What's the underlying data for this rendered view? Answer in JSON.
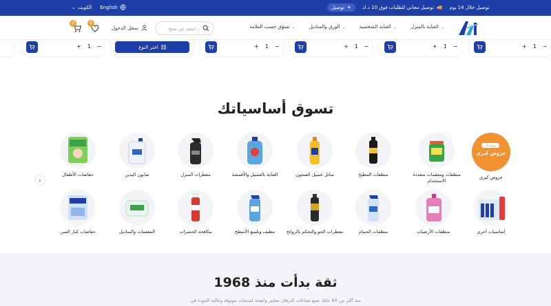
{
  "topbar": {
    "country": "الكويت",
    "language": "English",
    "promo_delivery": "توصيل",
    "promo_free": "توصيل مجاني للطلبات فوق 10 د.ك",
    "promo_deal": "توصيل خلال 14 يوم"
  },
  "header": {
    "nav": [
      {
        "label": "العناية بالمنزل"
      },
      {
        "label": "العناية الشخصية"
      },
      {
        "label": "الورق والمناديل"
      },
      {
        "label": "تسوّق حسب العلامة"
      }
    ],
    "search_placeholder": "ابحث عن منتج...",
    "login": "سجل الدخول",
    "wishlist_count": "0",
    "cart_count": "0"
  },
  "strip": {
    "qty_value": "1",
    "choose_label": "اختر النوع"
  },
  "section": {
    "title": "تسوق أساسياتك"
  },
  "categories_row1": [
    {
      "label": "عروض كبرى",
      "tag": "تسوق الآن"
    },
    {
      "label": "منظفات ومعقمات متعددة الاستخدام"
    },
    {
      "label": "منظفات المطبخ"
    },
    {
      "label": "سائل غسيل الصحون"
    },
    {
      "label": "العناية بالغسيل والأقمشة"
    },
    {
      "label": "معطرات المنزل"
    },
    {
      "label": "صابون اليدين"
    },
    {
      "label": "حفاضات الأطفال"
    }
  ],
  "categories_row2": [
    {
      "label": "أساسيات أخرى"
    },
    {
      "label": "منظفات الأرضيات"
    },
    {
      "label": "منظفات الحمام"
    },
    {
      "label": "معطرات الجو والتحكم بالروائح"
    },
    {
      "label": "تنظيف وتلميع الأسطح"
    },
    {
      "label": "مكافحة الحشرات"
    },
    {
      "label": "المعقمات والمناديل"
    },
    {
      "label": "حفاضات كبار السن"
    }
  ],
  "band": {
    "title": "ثقة بدأت منذ 1968",
    "text": "منذ أكثر من 60 عامًا، تضع صناعات البرهان معايير واضحة لمنتجات موثوقة وعالية الجودة في"
  },
  "colors": {
    "brand": "#1f3fa8",
    "accent": "#f29130"
  }
}
